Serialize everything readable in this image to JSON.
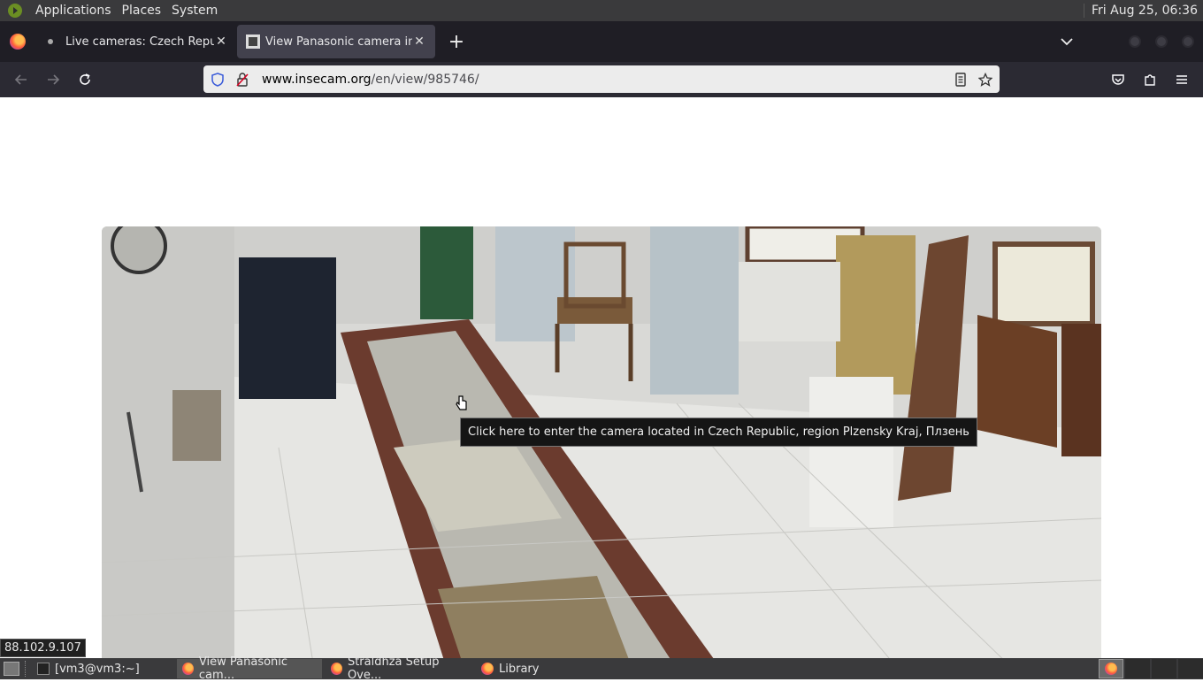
{
  "top_panel": {
    "menus": [
      "Applications",
      "Places",
      "System"
    ],
    "clock": "Fri Aug 25, 06:36"
  },
  "tabs": [
    {
      "title": "Live cameras: Czech Republ",
      "active": false
    },
    {
      "title": "View Panasonic camera in C",
      "active": true
    }
  ],
  "navbar": {
    "url_domain": "www.insecam.org",
    "url_path": "/en/view/985746/"
  },
  "page": {
    "tooltip": "Click here to enter the camera located in Czech Republic, region Plzensky Kraj, Плзень",
    "status_url": "88.102.9.107"
  },
  "taskbar": {
    "items": [
      {
        "label": "[vm3@vm3:~]",
        "icon": "terminal-icon"
      },
      {
        "label": "View Panasonic cam...",
        "icon": "firefox-icon"
      },
      {
        "label": "Straldhza Setup Ove...",
        "icon": "firefox-icon"
      },
      {
        "label": "Library",
        "icon": "firefox-icon"
      }
    ]
  },
  "colors": {
    "panel": "#3a3a3c",
    "tabstrip": "#1f1e25",
    "navbar": "#2b2a33",
    "urlbar": "#ececec"
  }
}
